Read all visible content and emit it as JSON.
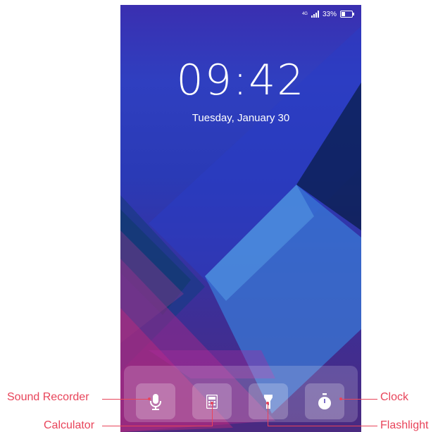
{
  "status_bar": {
    "network": "4G",
    "battery_percent": "33%"
  },
  "lock_screen": {
    "time": "09:42",
    "date": "Tuesday, January 30"
  },
  "shortcuts": [
    {
      "id": "sound-recorder",
      "icon": "microphone-icon",
      "label": "Sound Recorder"
    },
    {
      "id": "calculator",
      "icon": "calculator-icon",
      "label": "Calculator"
    },
    {
      "id": "flashlight",
      "icon": "flashlight-icon",
      "label": "Flashlight"
    },
    {
      "id": "clock",
      "icon": "stopwatch-icon",
      "label": "Clock"
    }
  ],
  "colors": {
    "callout": "#e8445a"
  }
}
